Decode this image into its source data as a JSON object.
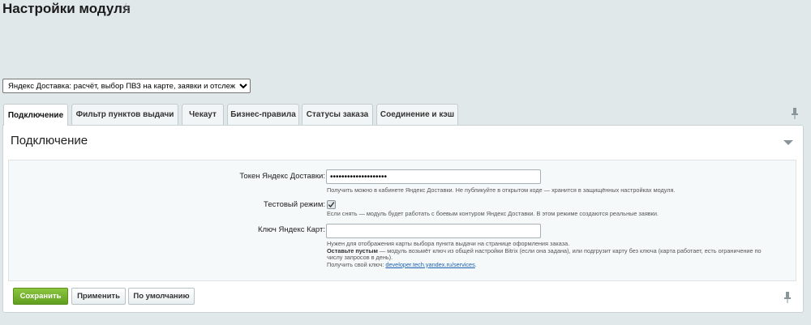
{
  "page": {
    "title": "Настройки модуля"
  },
  "module_select": {
    "value": "Яндекс Доставка: расчёт, выбор ПВЗ на карте, заявки и отслеживание"
  },
  "tabs": [
    {
      "label": "Подключение",
      "active": true
    },
    {
      "label": "Фильтр пунктов выдачи",
      "active": false
    },
    {
      "label": "Чекаут",
      "active": false
    },
    {
      "label": "Бизнес-правила",
      "active": false
    },
    {
      "label": "Статусы заказа",
      "active": false
    },
    {
      "label": "Соединение и кэш",
      "active": false
    }
  ],
  "section": {
    "title": "Подключение"
  },
  "form": {
    "token": {
      "label": "Токен Яндекс Доставки:",
      "value": "••••••••••••••••••••",
      "hint": "Получить можно в кабинете Яндекс Доставки. Не публикуйте в открытом коде — хранится в защищённых настройках модуля."
    },
    "test_mode": {
      "label": "Тестовый режим:",
      "checked": true,
      "hint": "Если снять — модуль будет работать с боевым контуром Яндекс Доставки. В этом режиме создаются реальные заявки."
    },
    "maps_key": {
      "label": "Ключ Яндекс Карт:",
      "value": "",
      "hint_line1": "Нужен для отображения карты выбора пункта выдачи на странице оформления заказа.",
      "hint_bold": "Оставьте пустым",
      "hint_line2": " — модуль возьмёт ключ из общей настройки Bitrix (если она задана), или подгрузит карту без ключа (карта работает, есть ограничение по",
      "hint_line3": "числу запросов в день).",
      "hint_link_prefix": "Получить свой ключ: ",
      "hint_link": "developer.tech.yandex.ru/services",
      "hint_link_suffix": "."
    }
  },
  "buttons": {
    "save": "Сохранить",
    "apply": "Применить",
    "defaults": "По умолчанию"
  },
  "colors": {
    "accent_green": "#6aa82a",
    "link_blue": "#1b5fae",
    "background": "#e0e8ea"
  }
}
